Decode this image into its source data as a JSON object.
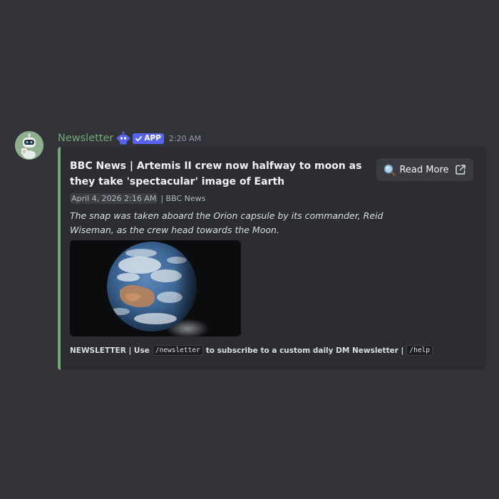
{
  "message": {
    "author": {
      "name": "Newsletter",
      "avatar_icon": "robot-mascot-icon",
      "badge_icon": "bot-face-icon",
      "app_badge": "APP",
      "name_color": "#74a874"
    },
    "timestamp": "2:20 AM",
    "embed": {
      "accent_color": "#74a874",
      "title": "BBC News | Artemis II crew now halfway to moon as they take 'spectacular' image of Earth",
      "date": "April 4, 2026 2:16 AM",
      "source": "| BBC News",
      "description": "The snap was taken aboard the Orion capsule by its commander, Reid Wiseman, as the crew head towards the Moon.",
      "image_icon": "earth-photo",
      "footer": {
        "prefix": "NEWSLETTER | Use",
        "command1": "/newsletter",
        "middle": "to subscribe to a custom daily DM Newsletter |",
        "command2": "/help"
      },
      "button": {
        "label": "Read More",
        "leading_icon": "magnifying-glass-icon",
        "trailing_icon": "external-link-icon"
      }
    }
  }
}
